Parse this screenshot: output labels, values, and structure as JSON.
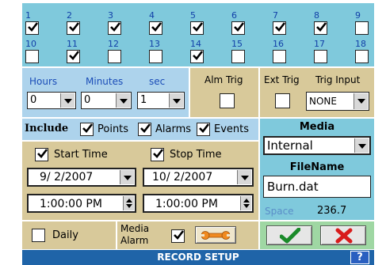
{
  "channels": [
    {
      "num": "1",
      "checked": true
    },
    {
      "num": "2",
      "checked": true
    },
    {
      "num": "3",
      "checked": true
    },
    {
      "num": "4",
      "checked": true
    },
    {
      "num": "5",
      "checked": true
    },
    {
      "num": "6",
      "checked": true
    },
    {
      "num": "7",
      "checked": true
    },
    {
      "num": "8",
      "checked": true
    },
    {
      "num": "9",
      "checked": false
    },
    {
      "num": "10",
      "checked": false
    },
    {
      "num": "11",
      "checked": true
    },
    {
      "num": "12",
      "checked": false
    },
    {
      "num": "13",
      "checked": false
    },
    {
      "num": "14",
      "checked": true
    },
    {
      "num": "15",
      "checked": false
    },
    {
      "num": "16",
      "checked": false
    },
    {
      "num": "17",
      "checked": false
    },
    {
      "num": "18",
      "checked": false
    }
  ],
  "time": {
    "hours_label": "Hours",
    "minutes_label": "Minutes",
    "sec_label": "sec",
    "hours_value": "0",
    "minutes_value": "0",
    "sec_value": "1"
  },
  "alm_trig": {
    "label": "Alm Trig",
    "checked": false
  },
  "ext_trig": {
    "label": "Ext Trig",
    "checked": false
  },
  "trig_input": {
    "label": "Trig Input",
    "value": "NONE"
  },
  "include": {
    "label": "Include",
    "points_label": "Points",
    "alarms_label": "Alarms",
    "events_label": "Events",
    "points": true,
    "alarms": true,
    "events": true
  },
  "start": {
    "label": "Start Time",
    "checked": true,
    "date": "9/ 2/2007",
    "time": "1:00:00 PM"
  },
  "stop": {
    "label": "Stop Time",
    "checked": true,
    "date": "10/ 2/2007",
    "time": "1:00:00 PM"
  },
  "media": {
    "label": "Media",
    "value": "Internal",
    "filename_label": "FileName",
    "filename": "Burn.dat",
    "space_label": "Space",
    "space_value": "236.7"
  },
  "bottom": {
    "daily_label": "Daily",
    "daily": false,
    "media_alarm_line1": "Media",
    "media_alarm_line2": "Alarm",
    "media_alarm": true
  },
  "title": "RECORD SETUP",
  "help_label": "?",
  "colors": {
    "teal": "#7fc9dc",
    "blue": "#add3ec",
    "tan": "#d8c99a",
    "green": "#9fd7a3",
    "titlebar": "#1f64a8",
    "ok_green": "#1a8a2a",
    "cancel_red": "#d81c1c"
  }
}
